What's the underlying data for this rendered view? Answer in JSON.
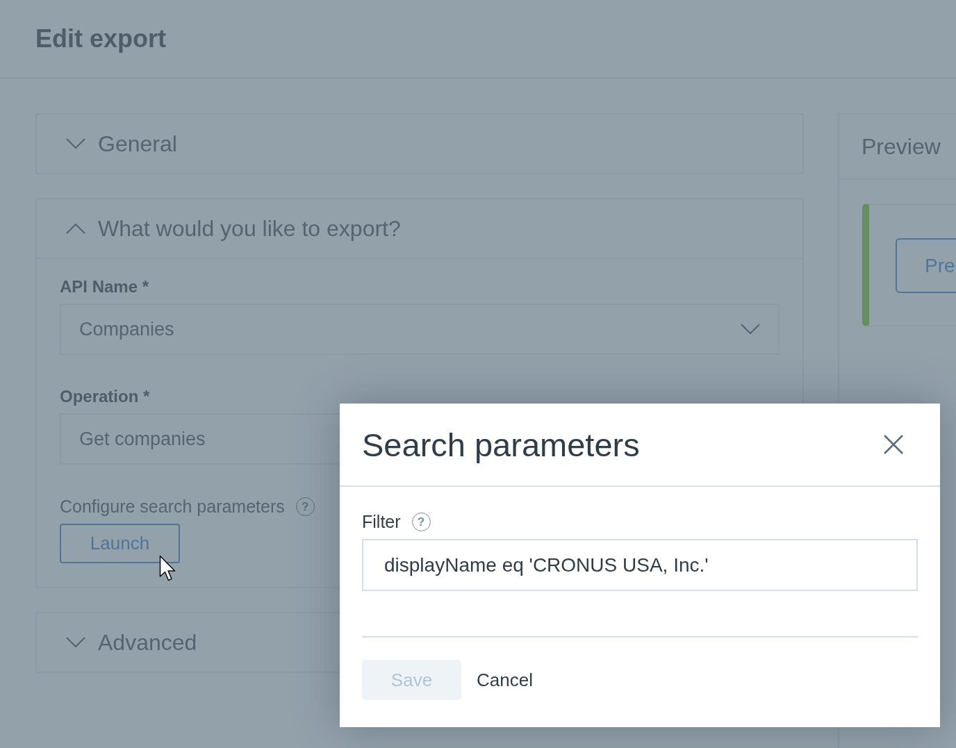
{
  "page": {
    "title": "Edit export"
  },
  "sections": [
    {
      "title": "General",
      "expanded": false
    },
    {
      "title": "What would you like to export?",
      "expanded": true,
      "content": {
        "api_name": {
          "label": "API Name *",
          "value": "Companies"
        },
        "operation": {
          "label": "Operation *",
          "value": "Get companies"
        },
        "search_parameters": {
          "label": "Configure search parameters",
          "help": "?",
          "button": "Launch"
        }
      }
    },
    {
      "title": "Advanced",
      "expanded": false
    }
  ],
  "preview_panel": {
    "title": "Preview",
    "button": "Pre"
  },
  "dialog": {
    "title": "Search parameters",
    "filter": {
      "label": "Filter",
      "help": "?",
      "value": "displayName eq 'CRONUS USA, Inc.'"
    },
    "buttons": [
      {
        "label": "Save",
        "kind": "primary",
        "disabled": true
      },
      {
        "label": "Cancel",
        "kind": "text",
        "disabled": false
      }
    ]
  }
}
